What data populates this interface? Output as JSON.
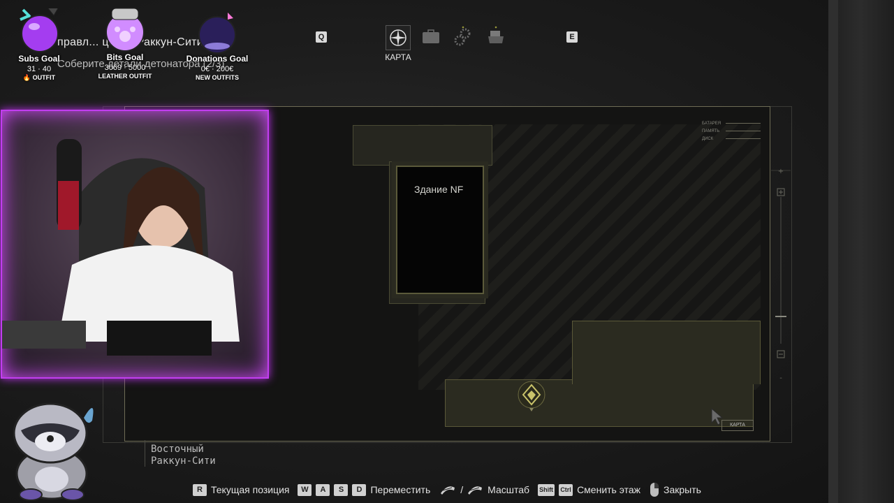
{
  "top_nav": {
    "left_key": "Q",
    "right_key": "E",
    "tabs": [
      {
        "icon": "compass-icon",
        "label": "КАРТА",
        "active": true
      },
      {
        "icon": "briefcase-icon",
        "active": false
      },
      {
        "icon": "gears-icon",
        "active": false
      },
      {
        "icon": "files-icon",
        "active": false
      }
    ]
  },
  "objective": {
    "title": "правл... центр Раккун-Сити",
    "subtitle": "Соберите детали детонатора (2/3)"
  },
  "map": {
    "building_label": "Здание NF",
    "legend": [
      "БАТАРЕЯ",
      "ПАМЯТЬ",
      "ДИСК"
    ],
    "map_tag": "КАРТА",
    "region_line1": "Восточный",
    "region_line2": "Раккун-Сити",
    "accent_color": "#c8c26a"
  },
  "controls": [
    {
      "keys": [
        "R"
      ],
      "label": "Текущая позиция"
    },
    {
      "keys": [
        "W",
        "A",
        "S",
        "D"
      ],
      "label": "Переместить"
    },
    {
      "icons": [
        "mouse-wheel-icon",
        "mouse-wheel-icon"
      ],
      "separator": "/",
      "label": "Масштаб"
    },
    {
      "keys": [
        "Shift",
        "Ctrl"
      ],
      "label": "Сменить этаж"
    },
    {
      "icons": [
        "mouse-right-icon"
      ],
      "label": "Закрыть"
    }
  ],
  "stream_overlay": {
    "goals": [
      {
        "name": "Subs Goal",
        "value": "31 · 40",
        "reward": "🔥 OUTFIT",
        "color": "#b84dff"
      },
      {
        "name": "Bits Goal",
        "value": "3069 · 5000",
        "reward": "LEATHER OUTFIT",
        "color": "#c77dff"
      },
      {
        "name": "Donations Goal",
        "value": "0€ · 200€",
        "reward": "NEW OUTFITS",
        "color": "#2a1f5a"
      }
    ],
    "webcam_border_color": "#d64dff"
  }
}
